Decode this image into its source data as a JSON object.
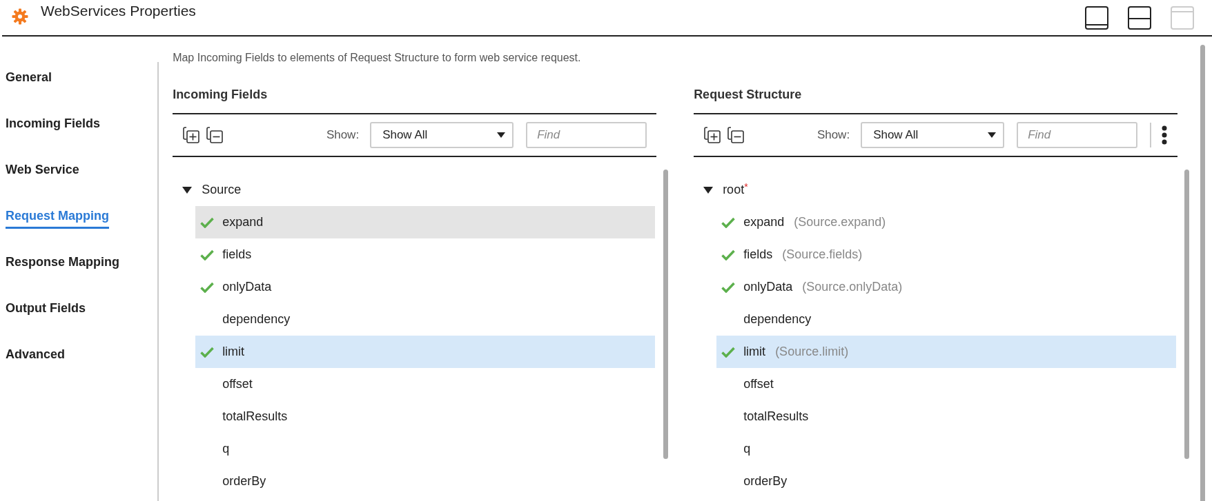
{
  "window": {
    "title": "WebServices Properties",
    "layout_buttons": [
      {
        "kind": "bottom-pane",
        "disabled": false
      },
      {
        "kind": "split-pane",
        "disabled": false
      },
      {
        "kind": "top-pane",
        "disabled": true
      }
    ]
  },
  "sidebar": {
    "items": [
      {
        "label": "General",
        "selected": false
      },
      {
        "label": "Incoming Fields",
        "selected": false
      },
      {
        "label": "Web Service",
        "selected": false
      },
      {
        "label": "Request Mapping",
        "selected": true
      },
      {
        "label": "Response Mapping",
        "selected": false
      },
      {
        "label": "Output Fields",
        "selected": false
      },
      {
        "label": "Advanced",
        "selected": false
      }
    ]
  },
  "description": "Map Incoming Fields to elements of Request Structure to form web service request.",
  "panels": [
    {
      "title": "Incoming Fields",
      "show_label": "Show:",
      "show_value": "Show All",
      "find_placeholder": "Find",
      "has_more_menu": false,
      "tree": {
        "label": "Source",
        "expanded": true,
        "children": [
          {
            "label": "expand",
            "checked": true,
            "hovered": true,
            "selected": false
          },
          {
            "label": "fields",
            "checked": true,
            "hovered": false,
            "selected": false
          },
          {
            "label": "onlyData",
            "checked": true,
            "hovered": false,
            "selected": false
          },
          {
            "label": "dependency",
            "checked": false,
            "hovered": false,
            "selected": false
          },
          {
            "label": "limit",
            "checked": true,
            "hovered": false,
            "selected": true
          },
          {
            "label": "offset",
            "checked": false,
            "hovered": false,
            "selected": false
          },
          {
            "label": "totalResults",
            "checked": false,
            "hovered": false,
            "selected": false
          },
          {
            "label": "q",
            "checked": false,
            "hovered": false,
            "selected": false
          },
          {
            "label": "orderBy",
            "checked": false,
            "hovered": false,
            "selected": false
          }
        ]
      }
    },
    {
      "title": "Request Structure",
      "show_label": "Show:",
      "show_value": "Show All",
      "find_placeholder": "Find",
      "has_more_menu": true,
      "tree": {
        "label": "root",
        "required_mark": "*",
        "expanded": true,
        "children": [
          {
            "label": "expand",
            "mapping": "(Source.expand)",
            "checked": true,
            "hovered": false,
            "selected": false
          },
          {
            "label": "fields",
            "mapping": "(Source.fields)",
            "checked": true,
            "hovered": false,
            "selected": false
          },
          {
            "label": "onlyData",
            "mapping": "(Source.onlyData)",
            "checked": true,
            "hovered": false,
            "selected": false
          },
          {
            "label": "dependency",
            "checked": false,
            "hovered": false,
            "selected": false
          },
          {
            "label": "limit",
            "mapping": "(Source.limit)",
            "checked": true,
            "hovered": false,
            "selected": true
          },
          {
            "label": "offset",
            "checked": false,
            "hovered": false,
            "selected": false
          },
          {
            "label": "totalResults",
            "checked": false,
            "hovered": false,
            "selected": false
          },
          {
            "label": "q",
            "checked": false,
            "hovered": false,
            "selected": false
          },
          {
            "label": "orderBy",
            "checked": false,
            "hovered": false,
            "selected": false
          }
        ]
      }
    }
  ]
}
